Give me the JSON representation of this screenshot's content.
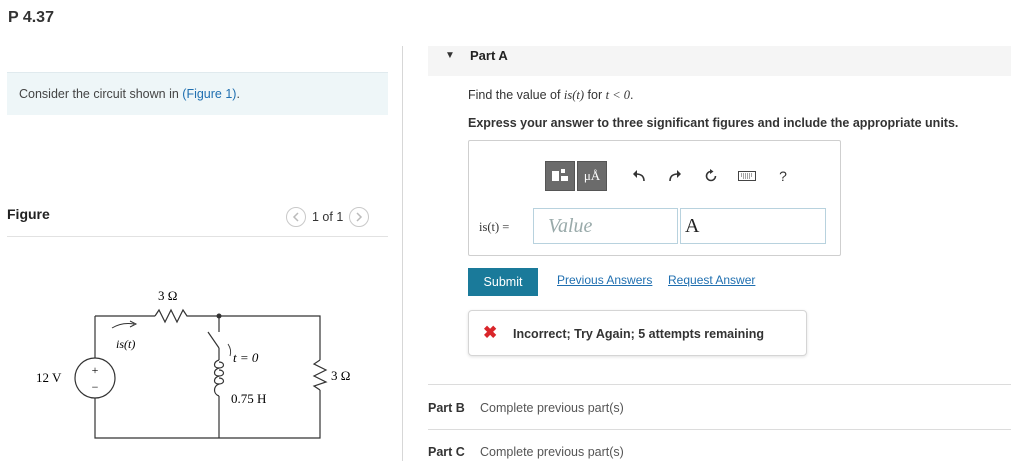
{
  "problem": {
    "title": "P 4.37"
  },
  "context": {
    "prefix": "Consider the circuit shown in ",
    "link": "(Figure 1)",
    "suffix": "."
  },
  "figure": {
    "label": "Figure",
    "pager": "1 of 1",
    "prev_icon": "chevron-left-icon",
    "next_icon": "chevron-right-icon",
    "circuit": {
      "source": "12 V",
      "r1": "3 Ω",
      "current_label": "is(t)",
      "switch": "t = 0",
      "inductor": "0.75 H",
      "r2": "3 Ω",
      "plus": "+",
      "minus": "−"
    }
  },
  "partA": {
    "title": "Part A",
    "question_prefix": "Find the value of ",
    "question_var": "is(t)",
    "question_mid": " for ",
    "question_cond": "t < 0",
    "question_suffix": ".",
    "instruction": "Express your answer to three significant figures and include the appropriate units.",
    "equation_label": "is(t) =",
    "value_placeholder": "Value",
    "unit_value": "A",
    "toolbar": {
      "templates_icon": "templates-icon",
      "units_label": "μÅ",
      "undo_icon": "undo-icon",
      "redo_icon": "redo-icon",
      "reset_icon": "reset-icon",
      "keyboard_icon": "keyboard-icon",
      "help_label": "?"
    },
    "submit_label": "Submit",
    "previous_answers": "Previous Answers",
    "request_answer": "Request Answer",
    "feedback": "Incorrect; Try Again; 5 attempts remaining"
  },
  "partB": {
    "label": "Part B",
    "status": "Complete previous part(s)"
  },
  "partC": {
    "label": "Part C",
    "status": "Complete previous part(s)"
  },
  "colors": {
    "submit": "#1a7a9a",
    "link": "#1f6fb0",
    "error": "#d9252a",
    "context_bg": "#eef6f8"
  }
}
